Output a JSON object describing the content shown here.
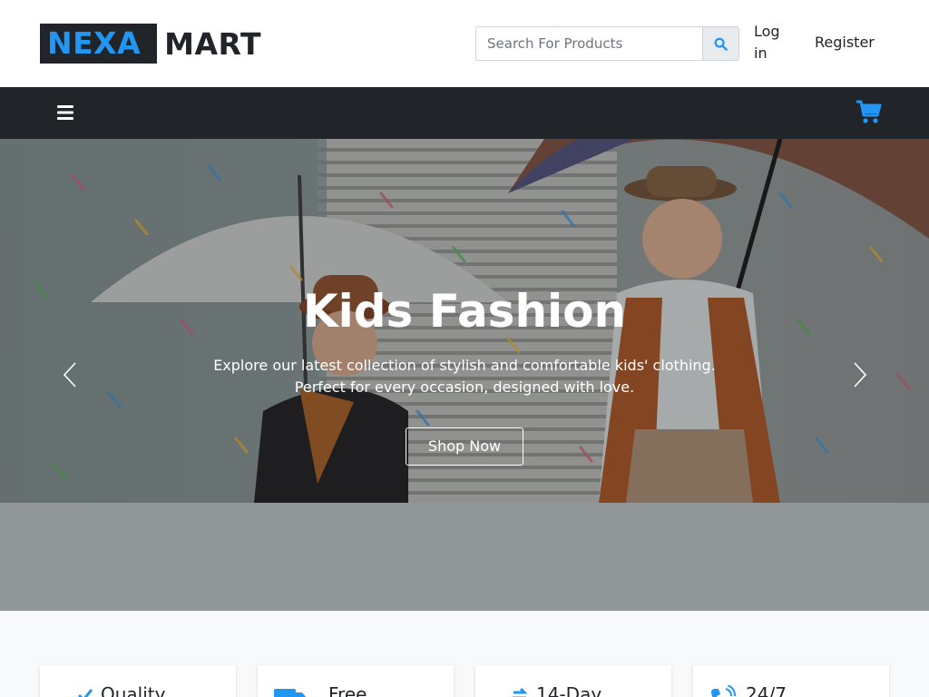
{
  "brand": {
    "prefix": "NEXA",
    "suffix": "MART",
    "accent": "#2196f3",
    "dark": "#212529"
  },
  "header": {
    "search_placeholder": "Search For Products",
    "search_icon": "search-icon",
    "login": "Log in",
    "register": "Register"
  },
  "navbar": {
    "menu_icon": "hamburger-icon",
    "cart_icon": "cart-icon"
  },
  "hero": {
    "title": "Kids Fashion",
    "subtitle": "Explore our latest collection of stylish and comfortable kids' clothing. Perfect for every occasion, designed with love.",
    "button": "Shop Now",
    "prev_icon": "chevron-left-icon",
    "next_icon": "chevron-right-icon"
  },
  "features": [
    {
      "label": "Quality",
      "icon": "check-icon"
    },
    {
      "label": "Free",
      "icon": "truck-icon"
    },
    {
      "label": "14-Day",
      "icon": "exchange-icon"
    },
    {
      "label": "24/7",
      "icon": "phone-volume-icon"
    }
  ]
}
